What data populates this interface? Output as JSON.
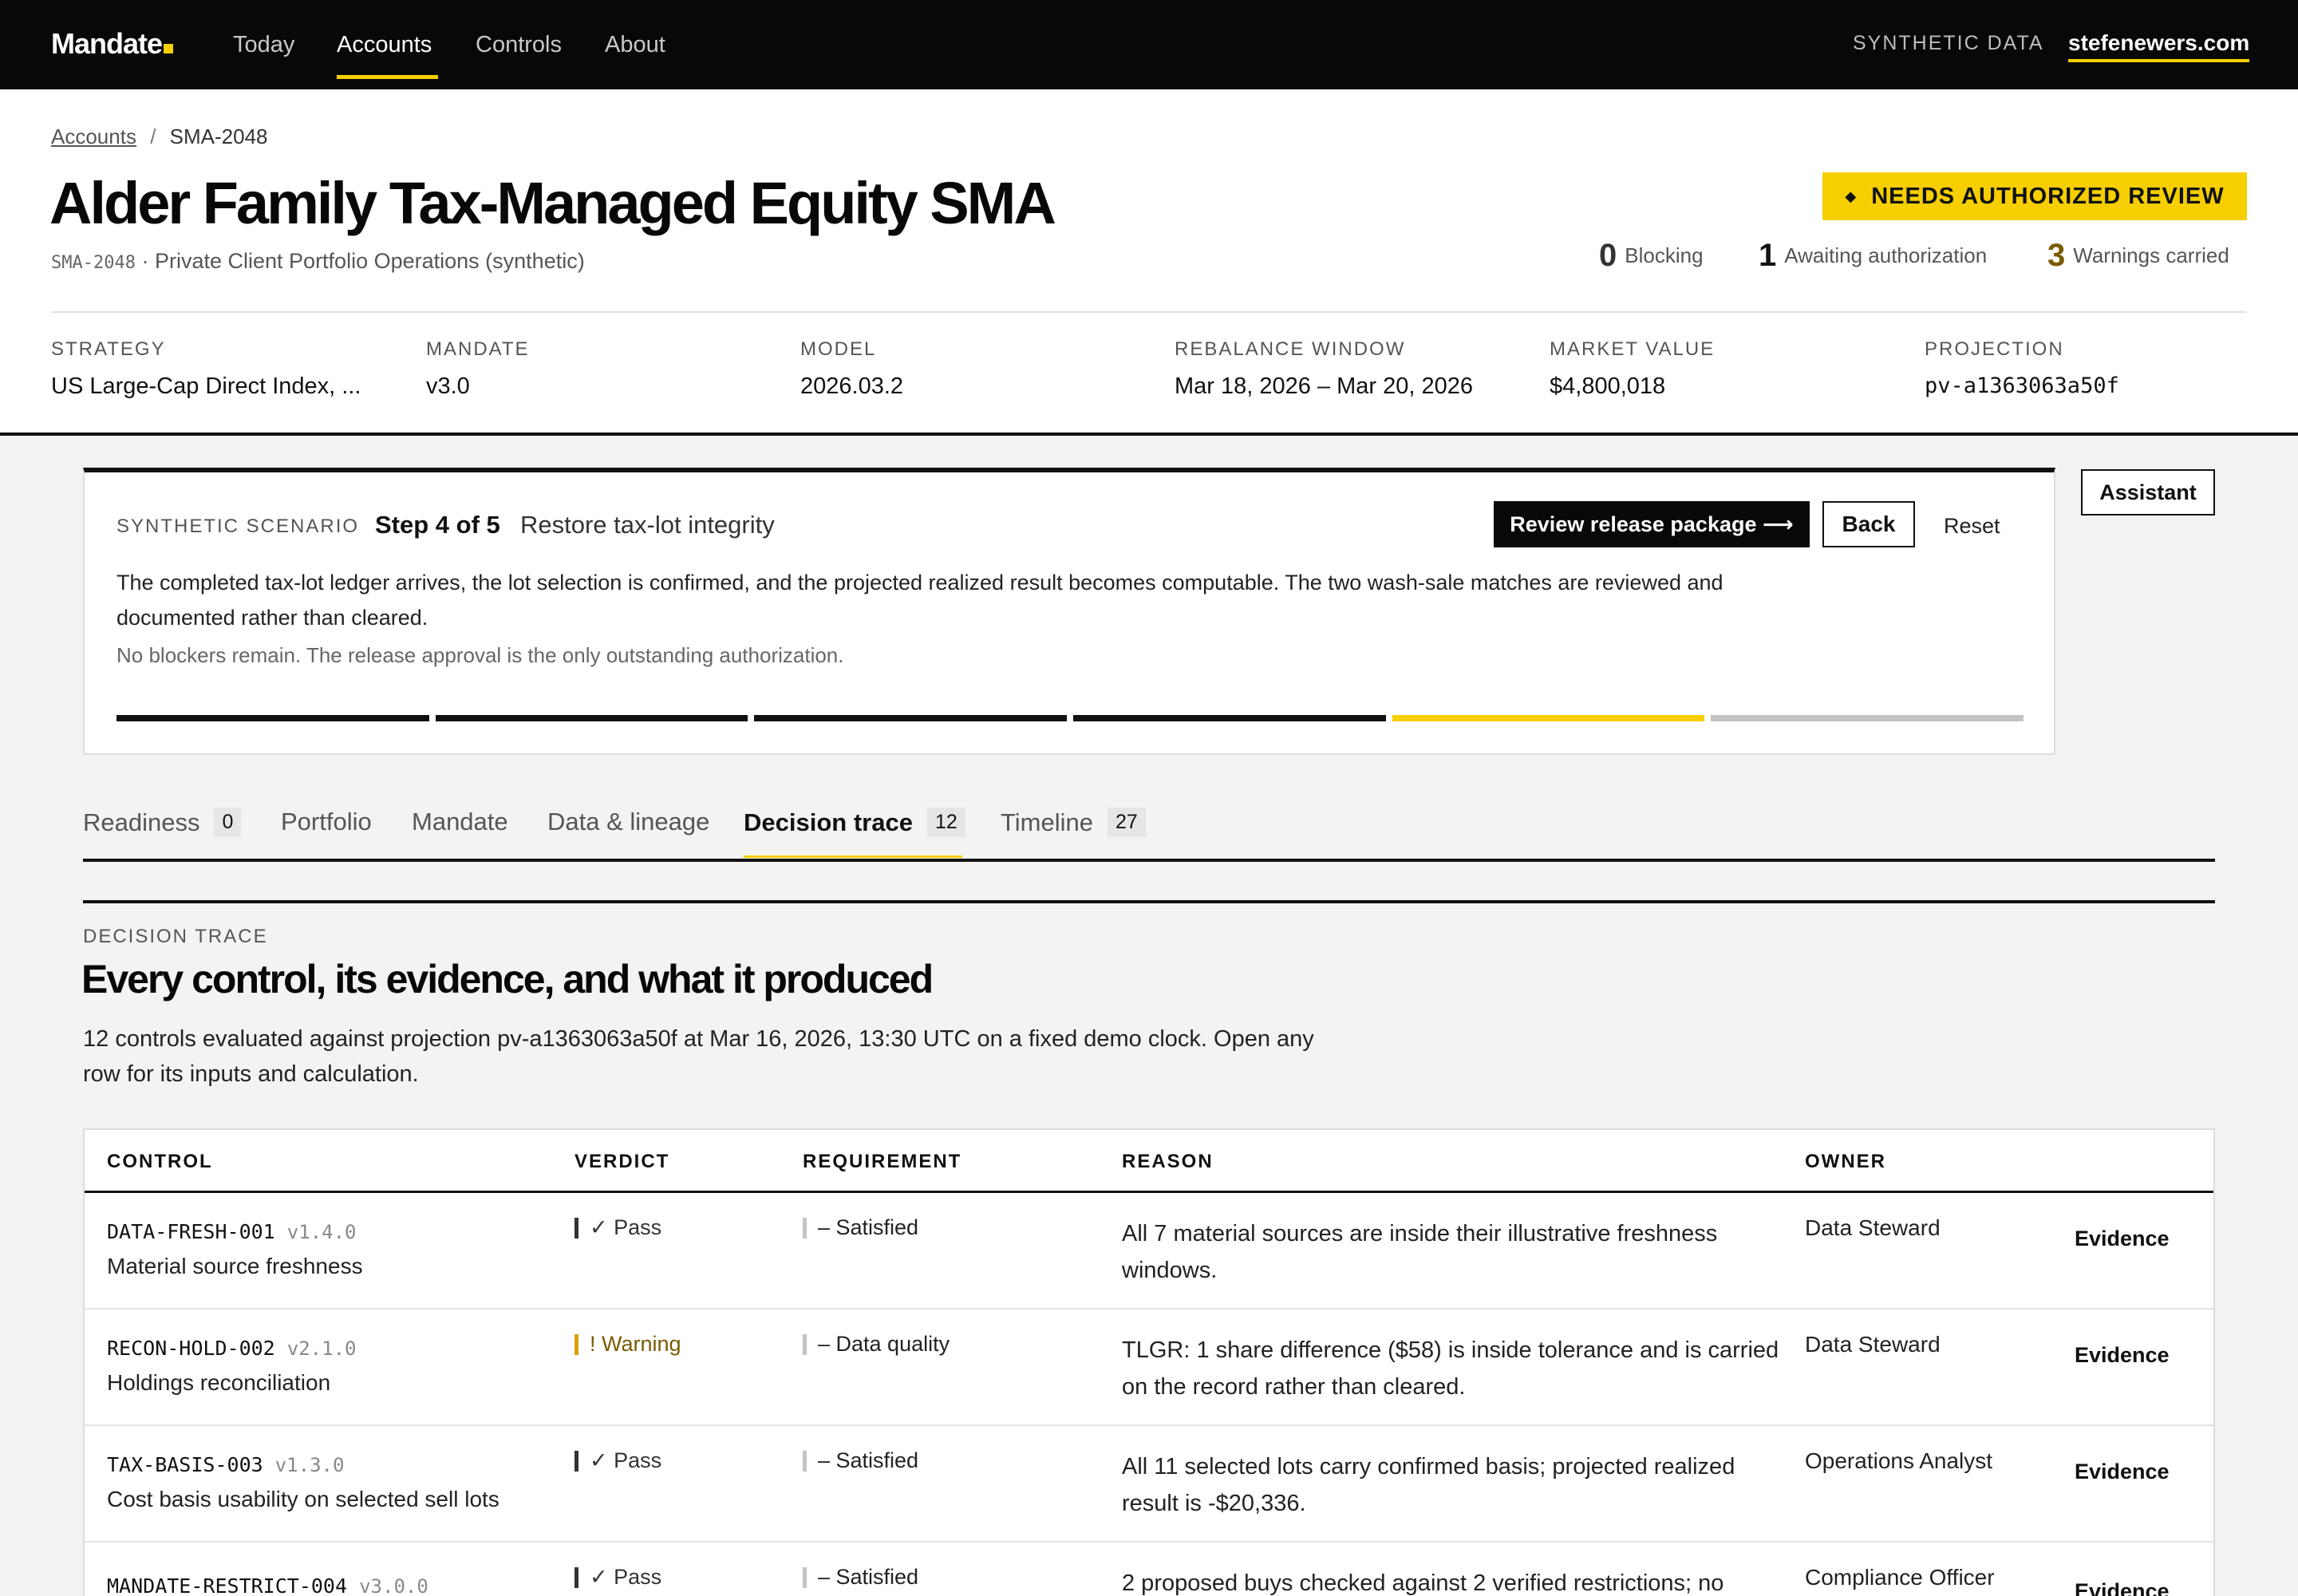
{
  "nav": {
    "brand": "Mandate",
    "links": [
      "Today",
      "Accounts",
      "Controls",
      "About"
    ],
    "right_label": "SYNTHETIC DATA",
    "site": "stefenewers.com"
  },
  "breadcrumb": {
    "parent": "Accounts",
    "separator": "/",
    "current": "SMA-2048"
  },
  "account": {
    "title": "Alder Family Tax-Managed Equity SMA",
    "id": "SMA-2048",
    "subtitle": "· Private Client Portfolio Operations (synthetic)",
    "status_badge": "NEEDS AUTHORIZED REVIEW",
    "counts": [
      {
        "value": "0",
        "label": "Blocking"
      },
      {
        "value": "1",
        "label": "Awaiting authorization"
      },
      {
        "value": "3",
        "label": "Warnings carried"
      }
    ],
    "meta": [
      {
        "label": "STRATEGY",
        "value": "US Large-Cap Direct Index, ..."
      },
      {
        "label": "MANDATE",
        "value": "v3.0"
      },
      {
        "label": "MODEL",
        "value": "2026.03.2"
      },
      {
        "label": "REBALANCE WINDOW",
        "value": "Mar 18, 2026 – Mar 20, 2026"
      },
      {
        "label": "MARKET VALUE",
        "value": "$4,800,018"
      },
      {
        "label": "PROJECTION",
        "value": "pv-a1363063a50f"
      }
    ]
  },
  "scenario": {
    "eyebrow": "SYNTHETIC SCENARIO",
    "step": "Step 4 of 5",
    "name": "Restore tax-lot integrity",
    "primary_button": "Review release package ⟶",
    "back_button": "Back",
    "reset_button": "Reset",
    "body": "The completed tax-lot ledger arrives, the lot selection is confirmed, and the projected realized result becomes computable. The two wash-sale matches are reviewed and documented rather than cleared.",
    "note": "No blockers remain. The release approval is the only outstanding authorization.",
    "progress": {
      "total_steps": 5,
      "current_step": 4
    }
  },
  "assistant_button": "Assistant",
  "tabs": [
    {
      "label": "Readiness",
      "count": "0"
    },
    {
      "label": "Portfolio",
      "count": ""
    },
    {
      "label": "Mandate",
      "count": ""
    },
    {
      "label": "Data & lineage",
      "count": ""
    },
    {
      "label": "Decision trace",
      "count": "12"
    },
    {
      "label": "Timeline",
      "count": "27"
    }
  ],
  "active_tab": "Decision trace",
  "decision_trace": {
    "eyebrow": "DECISION TRACE",
    "title": "Every control, its evidence, and what it produced",
    "description": "12 controls evaluated against projection pv-a1363063a50f at Mar 16, 2026, 13:30 UTC on a fixed demo clock. Open any row for its inputs and calculation.",
    "columns": [
      "CONTROL",
      "VERDICT",
      "REQUIREMENT",
      "REASON",
      "OWNER"
    ],
    "rows": [
      {
        "id": "DATA-FRESH-001",
        "version": "v1.4.0",
        "name": "Material source freshness",
        "verdict": "✓ Pass",
        "requirement": "– Satisfied",
        "reason": "All 7 material sources are inside their illustrative freshness windows.",
        "owner": "Data Steward",
        "action": "Evidence"
      },
      {
        "id": "RECON-HOLD-002",
        "version": "v2.1.0",
        "name": "Holdings reconciliation",
        "verdict": "! Warning",
        "requirement": "– Data quality",
        "reason": "TLGR: 1 share difference ($58) is inside tolerance and is carried on the record rather than cleared.",
        "owner": "Data Steward",
        "action": "Evidence"
      },
      {
        "id": "TAX-BASIS-003",
        "version": "v1.3.0",
        "name": "Cost basis usability on selected sell lots",
        "verdict": "✓ Pass",
        "requirement": "– Satisfied",
        "reason": "All 11 selected lots carry confirmed basis; projected realized result is -$20,336.",
        "owner": "Operations Analyst",
        "action": "Evidence"
      },
      {
        "id": "MANDATE-RESTRICT-004",
        "version": "v3.0.0",
        "name": "",
        "verdict": "✓ Pass",
        "requirement": "– Satisfied",
        "reason": "2 proposed buys checked against 2 verified restrictions; no",
        "owner": "Compliance Officer",
        "action": "Evidence"
      }
    ]
  },
  "colors": {
    "accent": "#f7cf00",
    "nav_bg": "#080808",
    "warning_text": "#7a5a00",
    "page_bg": "#f3f3f1"
  }
}
